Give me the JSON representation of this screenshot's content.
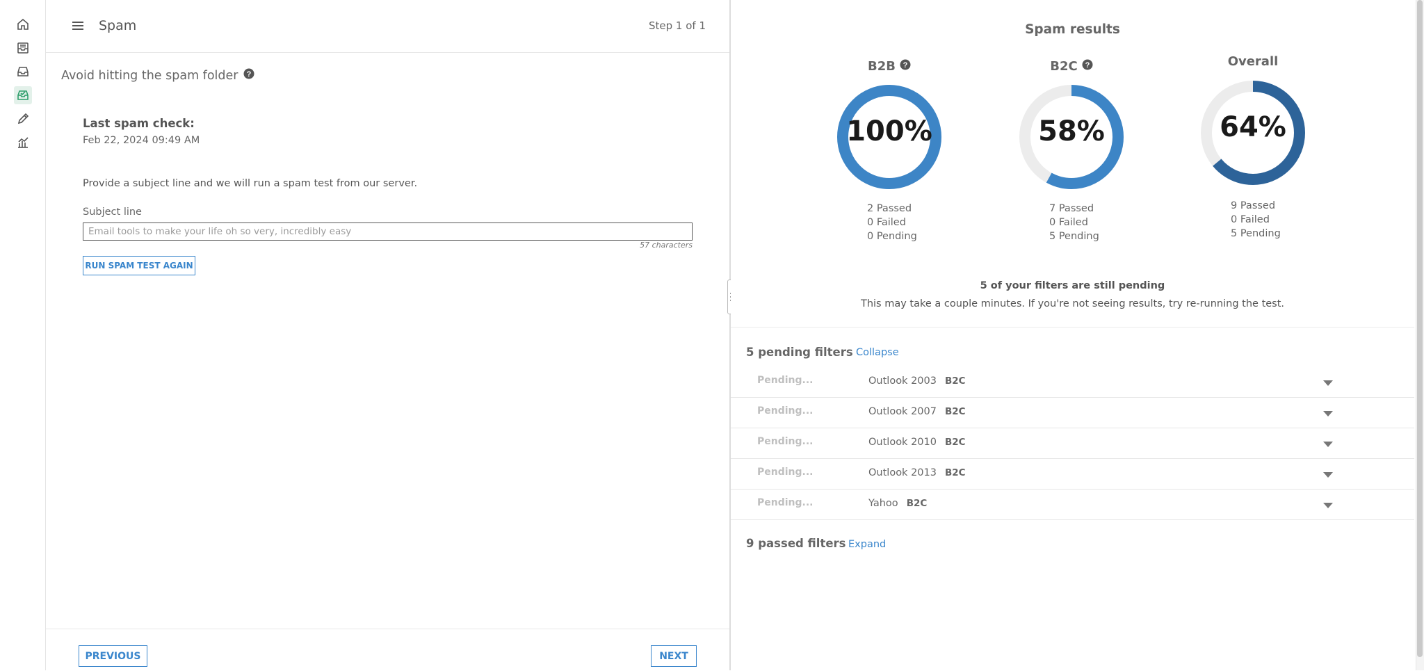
{
  "colors": {
    "accent": "#3a86cc",
    "active_nav": "#2e9e6b",
    "donut_light": "#3d85c6",
    "donut_dark": "#2d6399",
    "track": "#ececec"
  },
  "rail": {
    "icons": [
      "home-icon",
      "inbox-icon",
      "tray-icon",
      "mail-check-icon",
      "pencil-icon",
      "chart-icon"
    ],
    "active": "mail-check-icon"
  },
  "header": {
    "menu_icon": "hamburger-icon",
    "title": "Spam",
    "step": "Step 1 of 1"
  },
  "left": {
    "heading": "Avoid hitting the spam folder",
    "last_check_label": "Last spam check:",
    "last_check_value": "Feb 22, 2024 09:49 AM",
    "instructions": "Provide a subject line and we will run a spam test from our server.",
    "subject_label": "Subject line",
    "subject_value": "Email tools to make your life oh so very, incredibly easy",
    "char_count": "57 characters",
    "run_button": "RUN SPAM TEST AGAIN"
  },
  "footer": {
    "previous": "PREVIOUS",
    "next": "NEXT"
  },
  "results": {
    "title": "Spam results",
    "donuts": [
      {
        "label": "B2B",
        "help": true,
        "percent": 100,
        "percent_label": "100%",
        "passed": "2 Passed",
        "failed": "0 Failed",
        "pending": "0 Pending",
        "tone": "light"
      },
      {
        "label": "B2C",
        "help": true,
        "percent": 58,
        "percent_label": "58%",
        "passed": "7 Passed",
        "failed": "0 Failed",
        "pending": "5 Pending",
        "tone": "light"
      },
      {
        "label": "Overall",
        "help": false,
        "percent": 64,
        "percent_label": "64%",
        "passed": "9 Passed",
        "failed": "0 Failed",
        "pending": "5 Pending",
        "tone": "dark"
      }
    ],
    "pending_notice_title": "5 of your filters are still pending",
    "pending_notice_body": "This may take a couple minutes. If you're not seeing results, try re-running the test.",
    "pending_section": {
      "title": "5 pending filters",
      "toggle": "Collapse",
      "rows": [
        {
          "status": "Pending...",
          "client": "Outlook 2003",
          "tag": "B2C"
        },
        {
          "status": "Pending...",
          "client": "Outlook 2007",
          "tag": "B2C"
        },
        {
          "status": "Pending...",
          "client": "Outlook 2010",
          "tag": "B2C"
        },
        {
          "status": "Pending...",
          "client": "Outlook 2013",
          "tag": "B2C"
        },
        {
          "status": "Pending...",
          "client": "Yahoo",
          "tag": "B2C"
        }
      ]
    },
    "passed_section": {
      "title": "9 passed filters",
      "toggle": "Expand"
    }
  }
}
